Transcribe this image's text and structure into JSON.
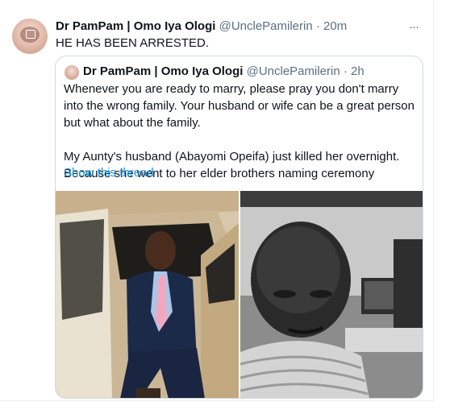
{
  "tweet": {
    "author_name": "Dr PamPam | Omo Iya Ologi",
    "author_handle": "@UnclePamilerin",
    "time": "20m",
    "more_icon": "···",
    "text": "HE HAS BEEN ARRESTED."
  },
  "quoted": {
    "author_name": "Dr PamPam | Omo Iya Ologi",
    "author_handle": "@UnclePamilerin",
    "time": "2h",
    "paragraph1": "Whenever you are ready to marry, please pray you don't marry into the wrong family. Your husband or wife can be a great person but what about the family.",
    "paragraph2": "My Aunty's husband (Abayomi Opeifa) just killed her overnight. Because she went to her elder brothers naming ceremony",
    "show_thread": "Show this thread"
  },
  "colors": {
    "link": "#1b95e0",
    "secondary_text": "#5b7083",
    "border": "#cfd9de"
  }
}
